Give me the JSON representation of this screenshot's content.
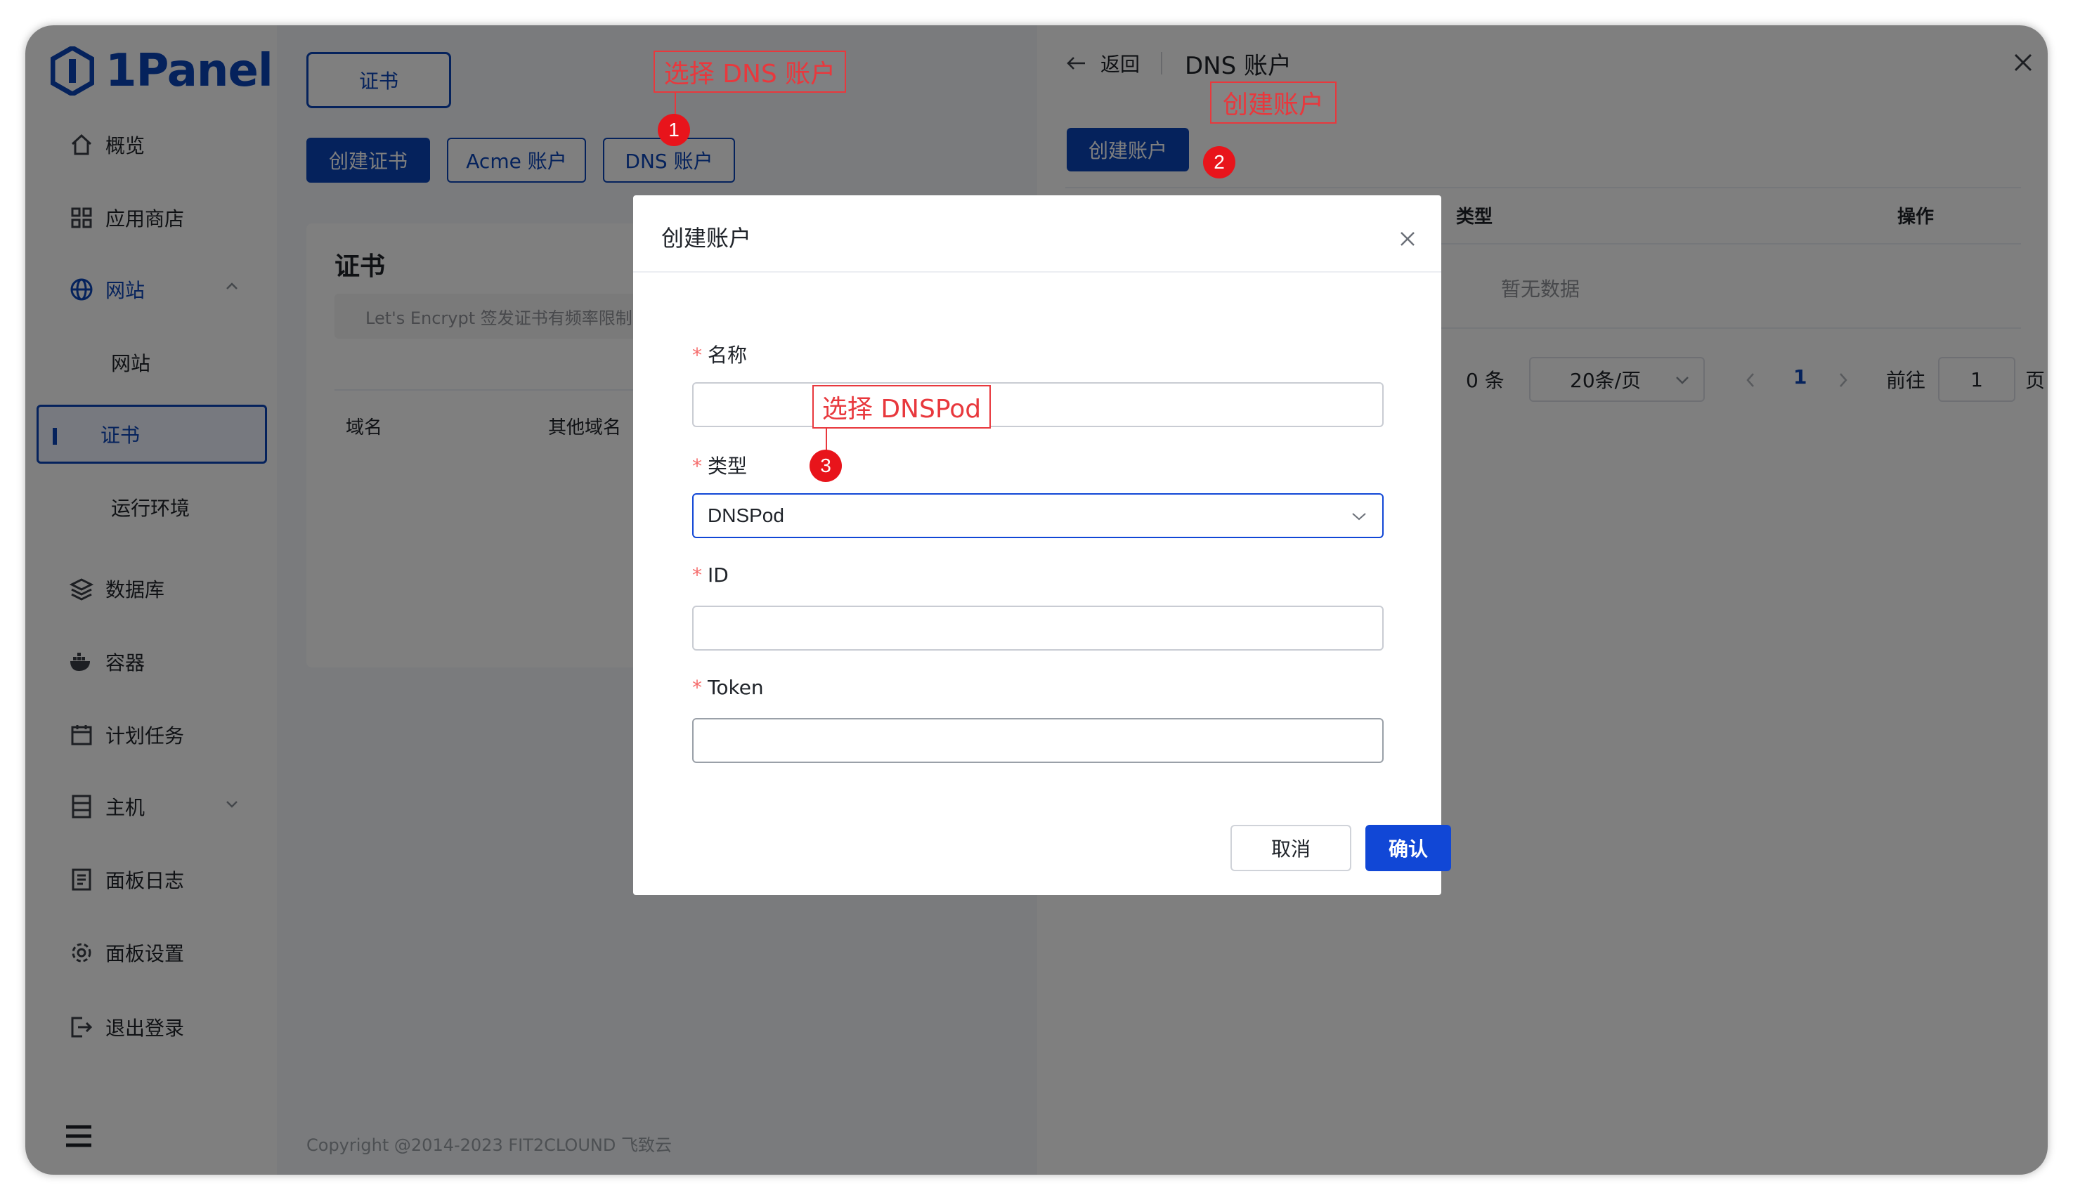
{
  "app": {
    "logo_text": "1Panel"
  },
  "sidebar": {
    "items": [
      {
        "label": "概览"
      },
      {
        "label": "应用商店"
      },
      {
        "label": "网站"
      },
      {
        "label": "网站"
      },
      {
        "label": "证书"
      },
      {
        "label": "运行环境"
      },
      {
        "label": "数据库"
      },
      {
        "label": "容器"
      },
      {
        "label": "计划任务"
      },
      {
        "label": "主机"
      },
      {
        "label": "面板日志"
      },
      {
        "label": "面板设置"
      },
      {
        "label": "退出登录"
      }
    ]
  },
  "main": {
    "tab_label": "证书",
    "buttons": {
      "create_cert": "创建证书",
      "acme_account": "Acme 账户",
      "dns_account": "DNS 账户"
    },
    "card_title": "证书",
    "notice": "Let's Encrypt 签发证书有频率限制",
    "table_headers": [
      "域名",
      "其他域名"
    ],
    "copyright": "Copyright @2014-2023 FIT2CLOUND 飞致云"
  },
  "drawer": {
    "back_label": "返回",
    "title": "DNS 账户",
    "create_button": "创建账户",
    "table_headers": {
      "type": "类型",
      "actions": "操作"
    },
    "empty_text": "暂无数据",
    "pagination": {
      "total_suffix": "0 条",
      "page_size": "20条/页",
      "current_page": "1",
      "goto_label": "前往",
      "goto_value": "1",
      "page_suffix": "页"
    }
  },
  "dialog": {
    "title": "创建账户",
    "fields": {
      "name": {
        "label": "名称",
        "value": ""
      },
      "type": {
        "label": "类型",
        "value": "DNSPod"
      },
      "id": {
        "label": "ID",
        "value": ""
      },
      "token": {
        "label": "Token",
        "value": ""
      }
    },
    "cancel_label": "取消",
    "confirm_label": "确认"
  },
  "annotations": [
    {
      "text": "选择 DNS 账户",
      "step": "1"
    },
    {
      "text": "创建账户",
      "step": "2"
    },
    {
      "text": "选择 DNSPod",
      "step": "3"
    }
  ],
  "colors": {
    "brand": "#0a45b8",
    "confirm": "#1147d6",
    "annotation": "#e8383d",
    "badge": "#e8141b"
  }
}
